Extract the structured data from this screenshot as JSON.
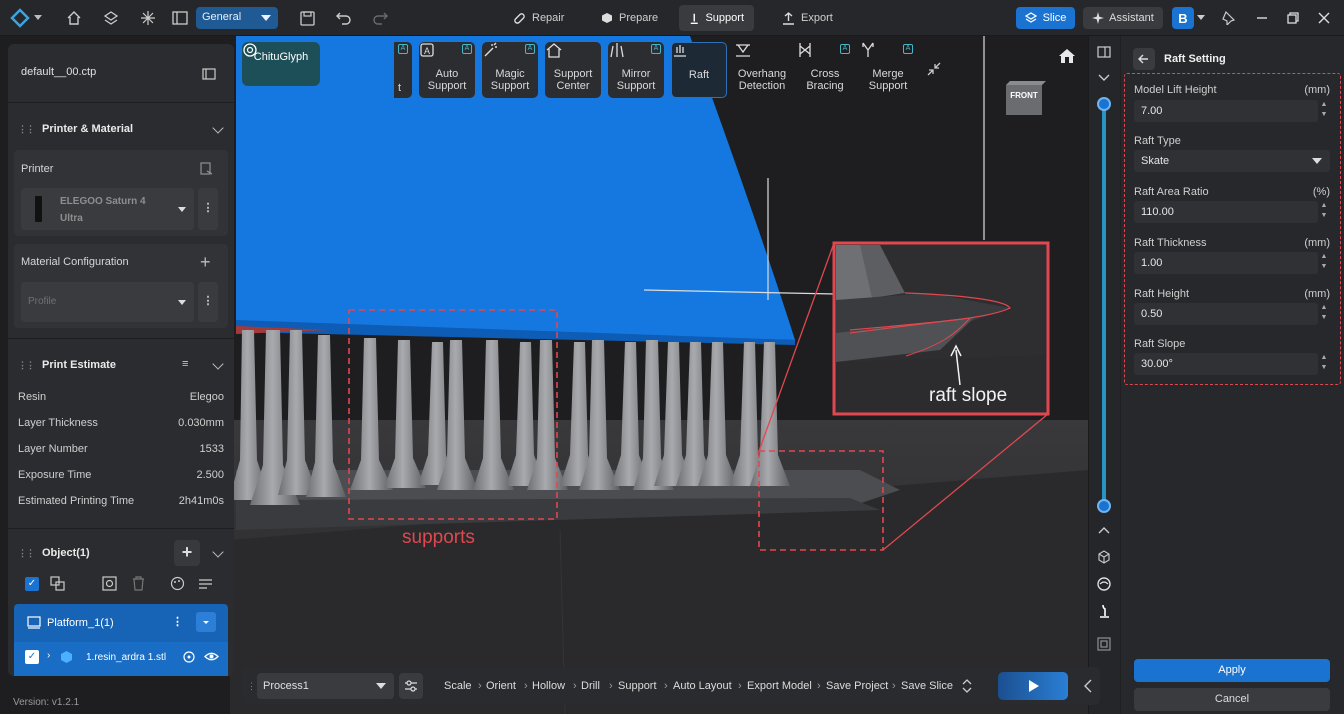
{
  "topbar": {
    "workspace": "General",
    "modes": [
      {
        "label": "Repair",
        "icon": "bandage-icon"
      },
      {
        "label": "Prepare",
        "icon": "cube-icon"
      },
      {
        "label": "Support",
        "icon": "support-icon"
      },
      {
        "label": "Export",
        "icon": "export-icon"
      }
    ],
    "slice_label": "Slice",
    "assistant_label": "Assistant",
    "b_label": "B"
  },
  "left": {
    "filename": "default__00.ctp",
    "printer_material_title": "Printer & Material",
    "printer_label": "Printer",
    "printer_name_line1": "ELEGOO Saturn 4",
    "printer_name_line2": "Ultra",
    "material_config_label": "Material Configuration",
    "profile_placeholder": "Profile",
    "print_estimate_title": "Print Estimate",
    "estimate": [
      {
        "label": "Resin",
        "value": "Elegoo"
      },
      {
        "label": "Layer Thickness",
        "value": "0.030mm"
      },
      {
        "label": "Layer Number",
        "value": "1533"
      },
      {
        "label": "Exposure Time",
        "value": "2.500"
      },
      {
        "label": "Estimated Printing Time",
        "value": "2h41m0s"
      }
    ],
    "object_title": "Object(1)",
    "platform_label": "Platform_1(1)",
    "stl_label": "1.resin_ardra 1.stl",
    "version": "Version: v1.2.1"
  },
  "toolbar": {
    "chitu_label": "ChituGlyph",
    "tools": [
      {
        "line1": "Auto",
        "line2": "Support",
        "badge": "A"
      },
      {
        "line1": "Magic",
        "line2": "Support",
        "badge": "A"
      },
      {
        "line1": "Support",
        "line2": "Center",
        "badge": ""
      },
      {
        "line1": "Mirror",
        "line2": "Support",
        "badge": "A"
      },
      {
        "line1": "Raft",
        "line2": "",
        "badge": ""
      },
      {
        "line1": "Overhang",
        "line2": "Detection",
        "badge": ""
      },
      {
        "line1": "Cross",
        "line2": "Bracing",
        "badge": "A"
      },
      {
        "line1": "Merge",
        "line2": "Support",
        "badge": "A"
      }
    ],
    "partial_badge": "A",
    "partial_text": "t"
  },
  "viewport": {
    "view_cube_label": "FRONT",
    "annotation_supports": "supports",
    "annotation_raft_slope": "raft slope"
  },
  "raft": {
    "title": "Raft Setting",
    "fields": [
      {
        "label": "Model Lift Height",
        "unit": "(mm)",
        "value": "7.00"
      },
      {
        "label": "Raft Type",
        "unit": "",
        "value": "Skate"
      },
      {
        "label": "Raft Area Ratio",
        "unit": "(%)",
        "value": "110.00"
      },
      {
        "label": "Raft Thickness",
        "unit": "(mm)",
        "value": "1.00"
      },
      {
        "label": "Raft Height",
        "unit": "(mm)",
        "value": "0.50"
      },
      {
        "label": "Raft Slope",
        "unit": "",
        "value": "30.00°"
      }
    ],
    "apply_label": "Apply",
    "cancel_label": "Cancel"
  },
  "bottombar": {
    "process": "Process1",
    "steps": [
      "Scale",
      "Orient",
      "Hollow",
      "Drill",
      "Support",
      "Auto Layout",
      "Export Model",
      "Save Project",
      "Save Slice"
    ],
    "separator": "›"
  },
  "colors": {
    "accent": "#1a73d1",
    "model_blue": "#1577e0",
    "annotation_red": "#e0484f"
  }
}
